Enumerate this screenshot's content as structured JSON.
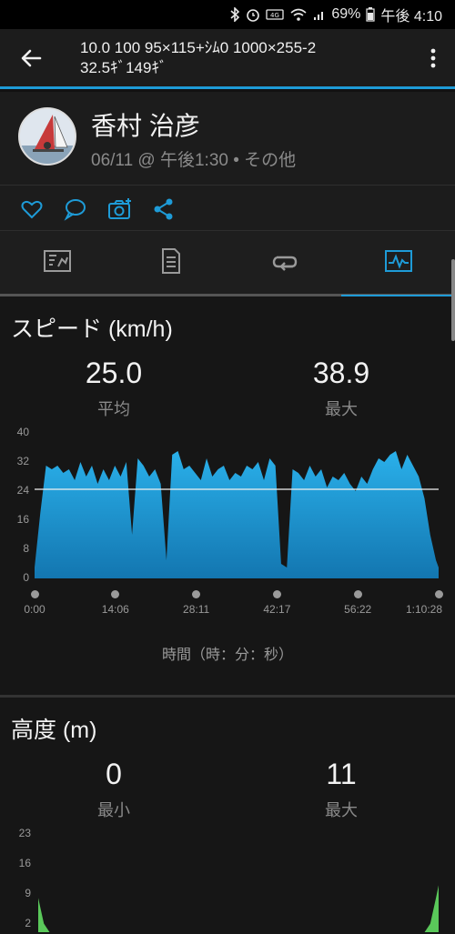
{
  "status_bar": {
    "battery_pct": "69%",
    "time": "午後 4:10",
    "icons": [
      "bluetooth-icon",
      "alarm-icon",
      "volte-icon",
      "wifi-icon",
      "signal-icon",
      "battery-icon"
    ]
  },
  "app_bar": {
    "title": "10.0 100 95×115+ｼﾑ0 1000×255-2\n32.5ｷﾞ149ｷﾞ",
    "accent": "#1e9bd7"
  },
  "profile": {
    "name": "香村 治彦",
    "meta": "06/11 @ 午後1:30 • その他"
  },
  "actions": [
    "like-icon",
    "comment-icon",
    "add-photo-icon",
    "share-icon"
  ],
  "tabs": [
    {
      "icon": "summary-icon",
      "active": false
    },
    {
      "icon": "details-icon",
      "active": false
    },
    {
      "icon": "laps-icon",
      "active": false
    },
    {
      "icon": "charts-icon",
      "active": true
    }
  ],
  "speed": {
    "title": "スピード (km/h)",
    "avg_value": "25.0",
    "avg_label": "平均",
    "max_value": "38.9",
    "max_label": "最大",
    "x_axis_label": "時間（時：分：秒）"
  },
  "altitude": {
    "title": "高度 (m)",
    "min_value": "0",
    "min_label": "最小",
    "max_value": "11",
    "max_label": "最大"
  },
  "chart_data": [
    {
      "type": "area",
      "y_ticks": [
        "0",
        "8",
        "16",
        "24",
        "32",
        "40"
      ],
      "ylim": [
        0,
        40
      ],
      "x_ticks": [
        "0:00",
        "14:06",
        "28:11",
        "42:17",
        "56:22",
        "1:10:28"
      ],
      "xlim_seconds": [
        0,
        4228
      ],
      "average_line": 24.5,
      "color": "#1e9bd7",
      "x_seconds": [
        0,
        60,
        120,
        180,
        240,
        300,
        360,
        420,
        480,
        540,
        600,
        660,
        720,
        780,
        840,
        900,
        960,
        1020,
        1080,
        1140,
        1200,
        1260,
        1320,
        1380,
        1440,
        1500,
        1560,
        1620,
        1680,
        1740,
        1800,
        1860,
        1920,
        1980,
        2040,
        2100,
        2160,
        2220,
        2280,
        2340,
        2400,
        2460,
        2520,
        2580,
        2640,
        2700,
        2760,
        2820,
        2880,
        2940,
        3000,
        3060,
        3120,
        3180,
        3240,
        3300,
        3360,
        3420,
        3480,
        3540,
        3600,
        3660,
        3720,
        3780,
        3840,
        3900,
        3960,
        4020,
        4080,
        4140,
        4200,
        4228
      ],
      "y_values": [
        3,
        18,
        31,
        30,
        31,
        29,
        30,
        27,
        32,
        28,
        31,
        26,
        30,
        27,
        31,
        28,
        32,
        12,
        33,
        31,
        28,
        30,
        26,
        5,
        34,
        35,
        30,
        31,
        29,
        27,
        33,
        28,
        30,
        31,
        27,
        29,
        28,
        31,
        30,
        32,
        27,
        33,
        31,
        4,
        3,
        30,
        29,
        27,
        31,
        28,
        30,
        25,
        28,
        27,
        29,
        26,
        24,
        28,
        26,
        30,
        33,
        32,
        34,
        35,
        30,
        34,
        31,
        28,
        22,
        12,
        5,
        3
      ]
    },
    {
      "type": "area",
      "y_ticks": [
        "2",
        "9",
        "16",
        "23"
      ],
      "ylim": [
        0,
        23
      ],
      "color": "#5ac85a",
      "x_seconds": [
        0,
        60,
        120,
        4080,
        4140,
        4200,
        4228
      ],
      "y_values": [
        8,
        2,
        0,
        0,
        2,
        8,
        11
      ]
    }
  ]
}
